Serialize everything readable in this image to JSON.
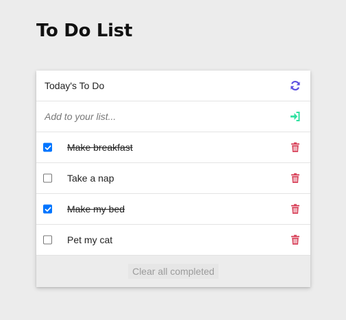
{
  "page": {
    "title": "To Do List"
  },
  "card": {
    "header_title": "Today's To Do",
    "refresh_icon": "refresh-icon",
    "add": {
      "placeholder": "Add to your list...",
      "value": "",
      "submit_icon": "sign-in-icon"
    },
    "items": [
      {
        "text": "Make breakfast",
        "completed": true
      },
      {
        "text": "Take a nap",
        "completed": false
      },
      {
        "text": "Make my bed",
        "completed": true
      },
      {
        "text": "Pet my cat",
        "completed": false
      }
    ],
    "delete_icon": "trash-icon",
    "footer": {
      "clear_label": "Clear all completed"
    }
  },
  "colors": {
    "background": "#ececec",
    "refresh_icon": "#5b4fe0",
    "submit_icon": "#2fe0a0",
    "delete_icon": "#d9485f",
    "checkbox_checked": "#0075ff"
  }
}
